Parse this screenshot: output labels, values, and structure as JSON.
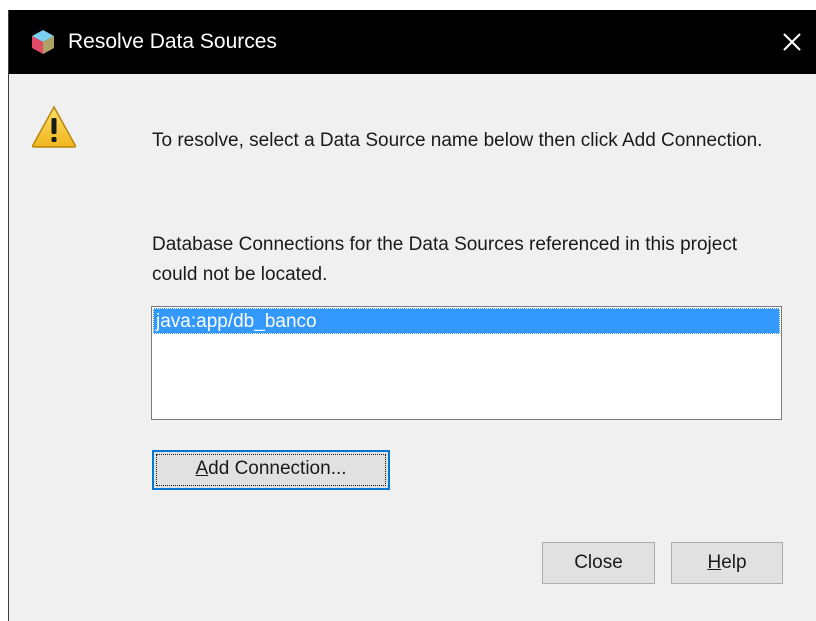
{
  "window": {
    "title": "Resolve Data Sources",
    "close_glyph": "✕"
  },
  "message": {
    "line1": "To resolve, select a Data Source name below then click Add Connection.",
    "line2": "Database Connections for the Data Sources referenced in this project could not be located."
  },
  "data_sources": {
    "items": [
      "java:app/db_banco"
    ],
    "selected_index": 0
  },
  "buttons": {
    "add_connection": {
      "mnemonic": "A",
      "rest": "dd Connection..."
    },
    "close": "Close",
    "help": {
      "mnemonic": "H",
      "rest": "elp"
    }
  },
  "colors": {
    "titlebar": "#000000",
    "dialog_bg": "#f0f0f0",
    "selection": "#3399ff",
    "focus_border": "#0078d7"
  },
  "icons": {
    "app": "netbeans-cube-icon",
    "warning": "warning-triangle-icon",
    "close": "close-icon"
  }
}
